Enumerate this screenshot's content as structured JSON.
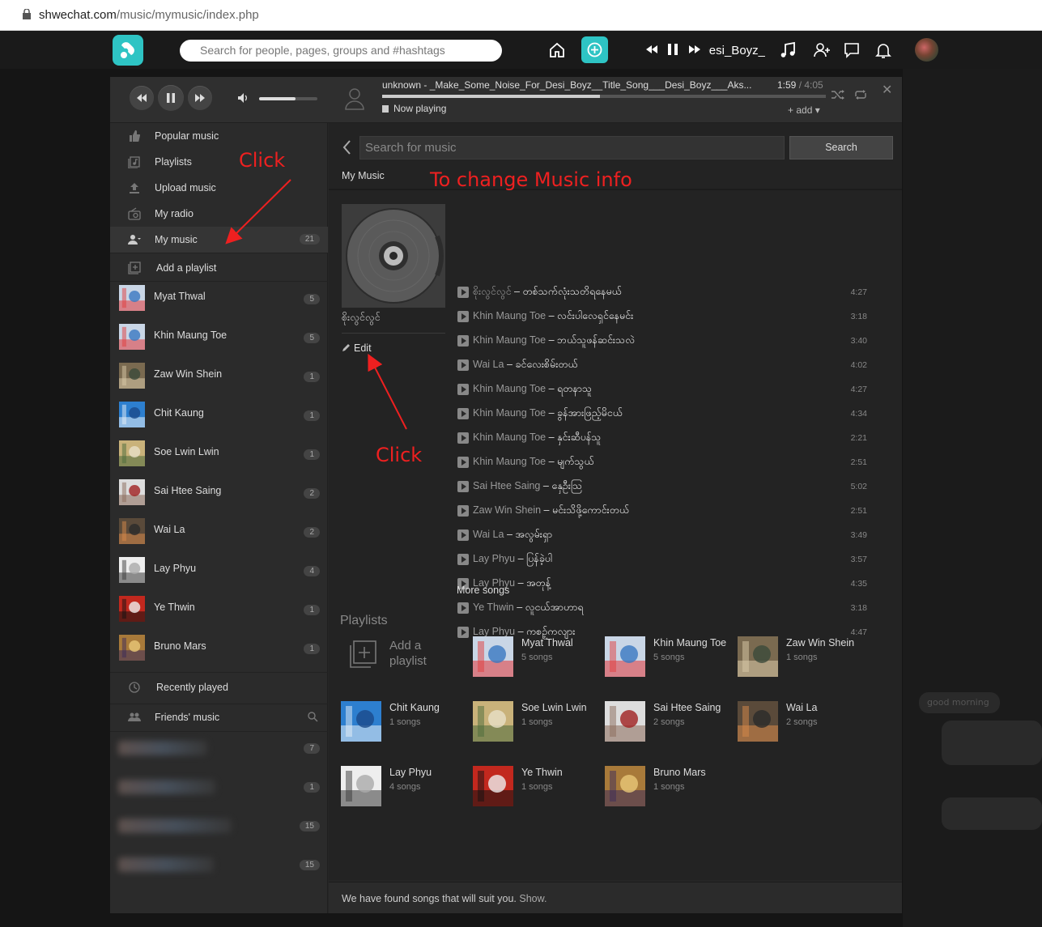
{
  "browser": {
    "url_host": "shwechat.com",
    "url_path": "/music/mymusic/index.php"
  },
  "topnav": {
    "search_placeholder": "Search for people, pages, groups and #hashtags",
    "mini_player_title": "_Make_Some_Noise_For_Desi_Boyz",
    "icons": [
      "home-icon",
      "plus-icon",
      "rewind-icon",
      "pause-icon",
      "forward-icon",
      "music-note-icon",
      "add-user-icon",
      "chat-icon",
      "bell-icon"
    ]
  },
  "player": {
    "title": "unknown - _Make_Some_Noise_For_Desi_Boyz__Title_Song___Desi_Boyz___Aks...",
    "current_time": "1:59",
    "duration": "/ 4:05",
    "progress": 0.49,
    "volume": 0.62,
    "now_playing": "Now playing",
    "add": "+ add ▾",
    "close": "✕"
  },
  "sidebar": {
    "nav": [
      {
        "label": "Popular music",
        "icon": "thumbs-up-icon"
      },
      {
        "label": "Playlists",
        "icon": "playlist-icon"
      },
      {
        "label": "Upload music",
        "icon": "upload-icon"
      },
      {
        "label": "My radio",
        "icon": "radio-icon"
      }
    ],
    "my_music": {
      "label": "My music",
      "count": "21"
    },
    "add_playlist": "Add a playlist",
    "artists": [
      {
        "name": "Myat Thwal",
        "count": "5"
      },
      {
        "name": "Khin Maung Toe",
        "count": "5"
      },
      {
        "name": "Zaw Win Shein",
        "count": "1"
      },
      {
        "name": "Chit Kaung",
        "count": "1"
      },
      {
        "name": "Soe Lwin Lwin",
        "count": "1"
      },
      {
        "name": "Sai Htee Saing",
        "count": "2"
      },
      {
        "name": "Wai La",
        "count": "2"
      },
      {
        "name": "Lay Phyu",
        "count": "4"
      },
      {
        "name": "Ye Thwin",
        "count": "1"
      },
      {
        "name": "Bruno Mars",
        "count": "1"
      }
    ],
    "recently_played": "Recently played",
    "friends_music": "Friends' music",
    "friends_counts": [
      "7",
      "1",
      "15",
      "15"
    ]
  },
  "main": {
    "search_placeholder": "Search for music",
    "search_button": "Search",
    "section_title": "My Music",
    "album_name": "စိုးလွင်လွင်",
    "edit": "Edit",
    "songs": [
      {
        "artist": "စိုးလွင်လွင်",
        "title": "တစ်သက်လုံးသတိရနေမယ်",
        "duration": "4:27"
      },
      {
        "artist": "Khin Maung Toe",
        "title": "လင်းပါလေရှင်နေမင်း",
        "duration": "3:18"
      },
      {
        "artist": "Khin Maung Toe",
        "title": "ဘယ်သူဖန်ဆင်းသလဲ",
        "duration": "3:40"
      },
      {
        "artist": "Wai La",
        "title": "ခင်လေးစိမ်းတယ်",
        "duration": "4:02"
      },
      {
        "artist": "Khin Maung Toe",
        "title": "ရတနာသူ",
        "duration": "4:27"
      },
      {
        "artist": "Khin Maung Toe",
        "title": "ခွန်အားဖြည့်မိငယ်",
        "duration": "4:34"
      },
      {
        "artist": "Khin Maung Toe",
        "title": "နှင်းဆီပန်သူ",
        "duration": "2:21"
      },
      {
        "artist": "Khin Maung Toe",
        "title": "မျက်သွယ်",
        "duration": "2:51"
      },
      {
        "artist": "Sai Htee Saing",
        "title": "နှေဦးသြ",
        "duration": "5:02"
      },
      {
        "artist": "Zaw Win Shein",
        "title": "မင်းသိဖို့ကောင်းတယ်",
        "duration": "2:51"
      },
      {
        "artist": "Wai La",
        "title": "အလွမ်းရှာ",
        "duration": "3:49"
      },
      {
        "artist": "Lay Phyu",
        "title": "ပြန်ခဲ့ပါ",
        "duration": "3:57"
      },
      {
        "artist": "Lay Phyu",
        "title": "အတုန့်",
        "duration": "4:35"
      },
      {
        "artist": "Ye Thwin",
        "title": "လူငယ်အာဟာရ",
        "duration": "3:18"
      },
      {
        "artist": "Lay Phyu",
        "title": "ကစဉ့်ကလျား",
        "duration": "4:47"
      }
    ],
    "more_songs": "More songs",
    "playlists_heading": "Playlists",
    "add_playlist_line1": "Add a",
    "add_playlist_line2": "playlist",
    "playlists": [
      {
        "name": "Myat Thwal",
        "count": "5 songs"
      },
      {
        "name": "Khin Maung Toe",
        "count": "5 songs"
      },
      {
        "name": "Zaw Win Shein",
        "count": "1 songs"
      },
      {
        "name": "Chit Kaung",
        "count": "1 songs"
      },
      {
        "name": "Soe Lwin Lwin",
        "count": "1 songs"
      },
      {
        "name": "Sai Htee Saing",
        "count": "2 songs"
      },
      {
        "name": "Wai La",
        "count": "2 songs"
      },
      {
        "name": "Lay Phyu",
        "count": "4 songs"
      },
      {
        "name": "Ye Thwin",
        "count": "1 songs"
      },
      {
        "name": "Bruno Mars",
        "count": "1 songs"
      }
    ],
    "footer_text": "We have found songs that will suit you.",
    "footer_show": "Show."
  },
  "annotations": {
    "click_sidebar": "Click",
    "change_info": "To change Music info",
    "click_edit": "Click",
    "color": "#ee2020"
  },
  "background_chat": {
    "bubble": "good morning"
  }
}
